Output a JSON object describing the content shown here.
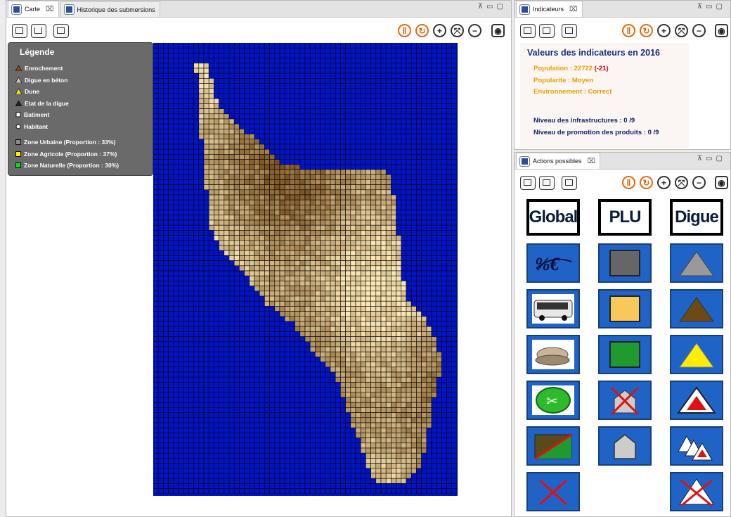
{
  "left_pane": {
    "tabs": [
      {
        "label": "Carte",
        "close": "⌧"
      },
      {
        "label": "Historique des submersions"
      }
    ]
  },
  "legend": {
    "title": "Légende",
    "items": [
      {
        "label": "Enrochement",
        "symbol": "triangle",
        "color": "#8b4a1c"
      },
      {
        "label": "Digue en béton",
        "symbol": "triangle",
        "color": "#cccccc"
      },
      {
        "label": "Dune",
        "symbol": "triangle",
        "color": "#ffee00"
      },
      {
        "label": "Etat de la digue",
        "symbol": "triangle",
        "color": "#222222"
      },
      {
        "label": "Batiment",
        "symbol": "square",
        "color": "#ffffff"
      },
      {
        "label": "Habitant",
        "symbol": "circle",
        "color": "#ffffff"
      }
    ],
    "zones": [
      {
        "label": "Zone Urbaine (Proportion : 33%)",
        "color": "#888888"
      },
      {
        "label": "Zone Agricole (Proportion : 37%)",
        "color": "#ffee00"
      },
      {
        "label": "Zone Naturelle (Proportion : 30%)",
        "color": "#11dd11"
      }
    ]
  },
  "map": {
    "sea_color": "#0015c8",
    "grid_color": "#000000",
    "cell_size": 7.2
  },
  "indicators_pane": {
    "tab": {
      "label": "Indicateurs",
      "close": "⌧"
    },
    "title": "Valeurs des indicateurs en 2016",
    "population_label": "Population : 22722",
    "population_delta": "(-21)",
    "popularite": "Popularite : Moyen",
    "environnement": "Environnement : Correct",
    "infrastructures": "Niveau des infrastructures : 0 /9",
    "promotion": "Niveau de promotion des produits : 0 /9"
  },
  "actions_pane": {
    "tab": {
      "label": "Actions possibles",
      "close": "⌧"
    },
    "columns": [
      {
        "header": "Global",
        "buttons": [
          "taxes-icon",
          "bus-icon",
          "oyster-icon",
          "tools-icon",
          "cancel-zone-icon",
          "cancel-icon"
        ]
      },
      {
        "header": "PLU",
        "buttons": [
          "urban-zone-icon",
          "agricultural-zone-icon",
          "natural-zone-icon",
          "cancel-building-icon",
          "building-icon"
        ]
      },
      {
        "header": "Digue",
        "buttons": [
          "concrete-dike-icon",
          "rockfill-dike-icon",
          "dune-icon",
          "repair-dike-icon",
          "raise-dike-icon",
          "remove-dike-icon"
        ]
      }
    ]
  },
  "colors": {
    "accent": "#2063c7",
    "orange_text": "#e8a000",
    "navy_text": "#10206a",
    "red_text": "#cc0000"
  }
}
